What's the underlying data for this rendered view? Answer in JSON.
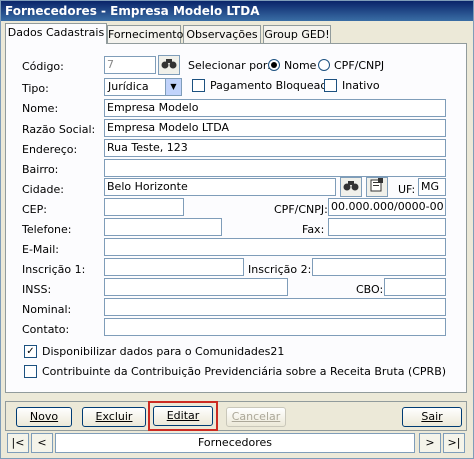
{
  "window": {
    "title": "Fornecedores - Empresa Modelo LTDA"
  },
  "tabs": [
    {
      "label": "Dados Cadastrais"
    },
    {
      "label": "Fornecimento"
    },
    {
      "label": "Observações"
    },
    {
      "label": "Group GED!"
    }
  ],
  "form": {
    "codigo": {
      "label": "Código:",
      "value": "7"
    },
    "selecionar": {
      "label": "Selecionar por:",
      "options": [
        "Nome",
        "CPF/CNPJ"
      ],
      "selected": "Nome"
    },
    "tipo": {
      "label": "Tipo:",
      "value": "Jurídica"
    },
    "pagamento_bloqueado": {
      "label": "Pagamento Bloqueado",
      "checked": false
    },
    "inativo": {
      "label": "Inativo",
      "checked": false
    },
    "nome": {
      "label": "Nome:",
      "value": "Empresa Modelo"
    },
    "razao_social": {
      "label": "Razão Social:",
      "value": "Empresa Modelo LTDA"
    },
    "endereco": {
      "label": "Endereço:",
      "value": "Rua Teste, 123"
    },
    "bairro": {
      "label": "Bairro:",
      "value": ""
    },
    "cidade": {
      "label": "Cidade:",
      "value": "Belo Horizonte"
    },
    "uf": {
      "label": "UF:",
      "value": "MG"
    },
    "cep": {
      "label": "CEP:",
      "value": ""
    },
    "cpf_cnpj": {
      "label": "CPF/CNPJ:",
      "value": "00.000.000/0000-00"
    },
    "telefone": {
      "label": "Telefone:",
      "value": ""
    },
    "fax": {
      "label": "Fax:",
      "value": ""
    },
    "email": {
      "label": "E-Mail:",
      "value": ""
    },
    "inscricao1": {
      "label": "Inscrição 1:",
      "value": ""
    },
    "inscricao2": {
      "label": "Inscrição 2:",
      "value": ""
    },
    "inss": {
      "label": "INSS:",
      "value": ""
    },
    "cbo": {
      "label": "CBO:",
      "value": ""
    },
    "nominal": {
      "label": "Nominal:",
      "value": ""
    },
    "contato": {
      "label": "Contato:",
      "value": ""
    },
    "comunidades": {
      "label": "Disponibilizar dados para o Comunidades21",
      "checked": true
    },
    "cprb": {
      "label": "Contribuinte da Contribuição Previdenciária sobre a Receita Bruta (CPRB)",
      "checked": false
    }
  },
  "buttons": {
    "novo": "Novo",
    "excluir": "Excluir",
    "editar": "Editar",
    "cancelar": "Cancelar",
    "sair": "Sair"
  },
  "navigator": {
    "first": "|<",
    "prev": "<",
    "label": "Fornecedores",
    "next": ">",
    "last": ">|"
  },
  "colors": {
    "highlight": "#cc2b22",
    "titlebar": "#0a246a"
  }
}
